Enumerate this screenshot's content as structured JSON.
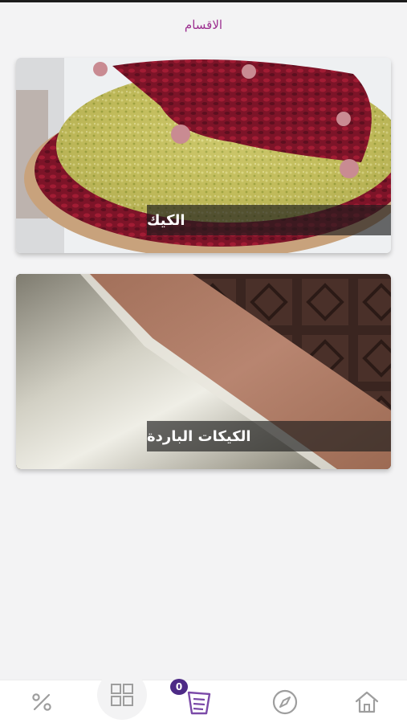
{
  "header": {
    "title": "الاقسام"
  },
  "categories": [
    {
      "label": "الكيك"
    },
    {
      "label": "الكيكات الباردة"
    }
  ],
  "bottom_nav": {
    "items": [
      {
        "icon": "percent-icon"
      },
      {
        "icon": "grid-icon"
      },
      {
        "icon": "cart-icon"
      },
      {
        "icon": "compass-icon"
      },
      {
        "icon": "home-icon"
      }
    ],
    "cart_count": "0"
  },
  "colors": {
    "accent": "#9c2f8f",
    "badge": "#4d2a86",
    "icon_gray": "#9e9e9e"
  }
}
